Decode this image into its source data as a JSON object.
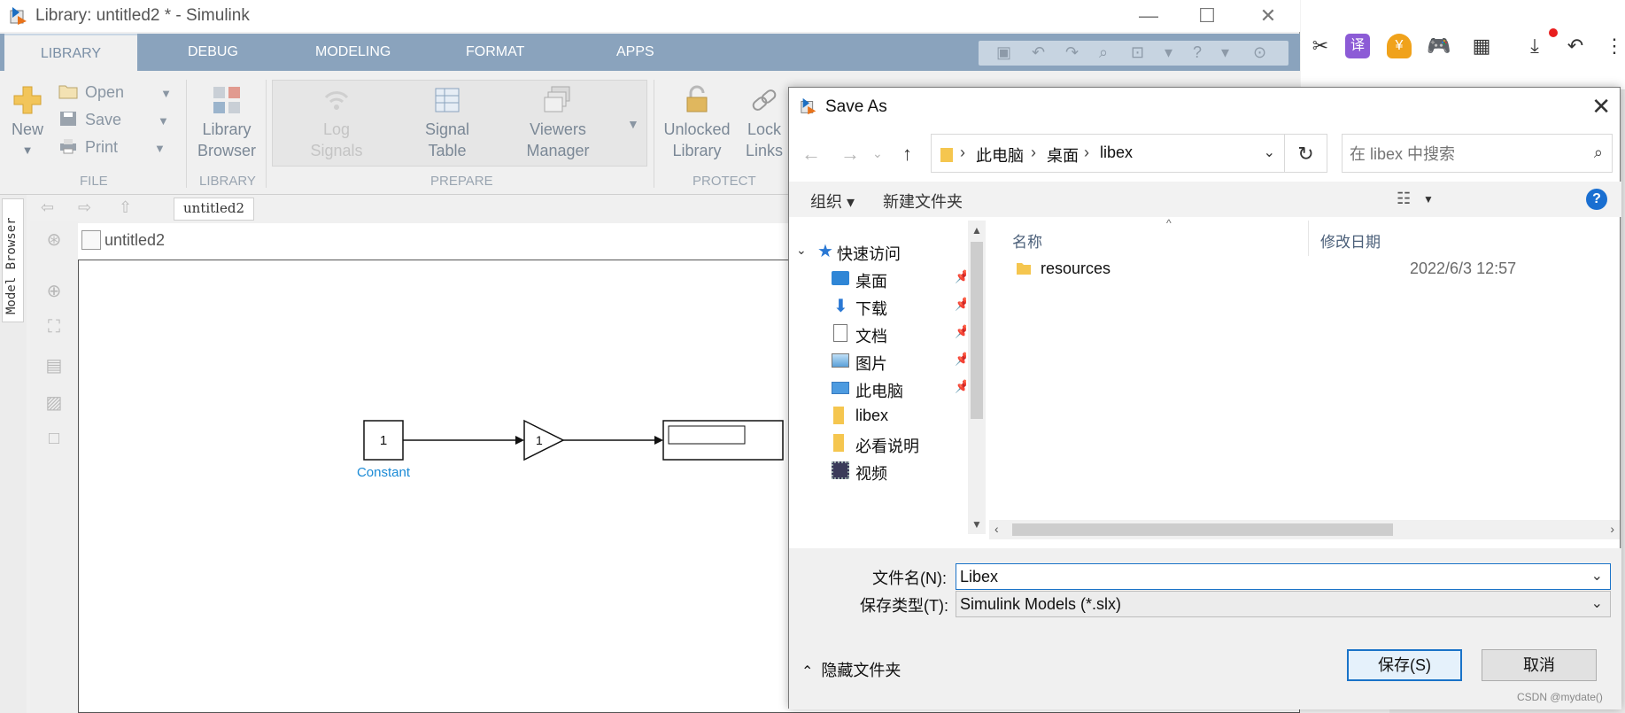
{
  "simulink": {
    "title": "Library: untitled2 * - Simulink",
    "tabs": [
      "LIBRARY",
      "DEBUG",
      "MODELING",
      "FORMAT",
      "APPS"
    ],
    "file_group": {
      "new": "New",
      "open": "Open",
      "save": "Save",
      "print": "Print",
      "group_label": "FILE"
    },
    "library_group": {
      "browser_line1": "Library",
      "browser_line2": "Browser",
      "group_label": "LIBRARY"
    },
    "prepare_group": {
      "log_line1": "Log",
      "log_line2": "Signals",
      "signal_line1": "Signal",
      "signal_line2": "Table",
      "viewers_line1": "Viewers",
      "viewers_line2": "Manager",
      "group_label": "PREPARE"
    },
    "protect_group": {
      "unlocked_line1": "Unlocked",
      "unlocked_line2": "Library",
      "lock_line1": "Lock",
      "lock_line2": "Links",
      "group_label": "PROTECT"
    },
    "side_tab": "Model Browser",
    "breadcrumb": "untitled2",
    "canvas_title": "untitled2",
    "blocks": {
      "constant_value": "1",
      "constant_label": "Constant",
      "gain_value": "1"
    }
  },
  "dialog": {
    "title": "Save As",
    "path": [
      "此电脑",
      "桌面",
      "libex"
    ],
    "search_placeholder": "在 libex 中搜索",
    "organize": "组织 ▾",
    "new_folder": "新建文件夹",
    "nav_items": [
      {
        "label": "快速访问",
        "icon": "star-icon",
        "pinned": false
      },
      {
        "label": "桌面",
        "icon": "desktop-icon",
        "pinned": true
      },
      {
        "label": "下载",
        "icon": "download-icon",
        "pinned": true
      },
      {
        "label": "文档",
        "icon": "document-icon",
        "pinned": true
      },
      {
        "label": "图片",
        "icon": "picture-icon",
        "pinned": true
      },
      {
        "label": "此电脑",
        "icon": "computer-icon",
        "pinned": true
      },
      {
        "label": "libex",
        "icon": "folder-icon",
        "pinned": false
      },
      {
        "label": "必看说明",
        "icon": "folder-icon",
        "pinned": false
      },
      {
        "label": "视频",
        "icon": "video-icon",
        "pinned": false
      }
    ],
    "columns": {
      "name": "名称",
      "date": "修改日期"
    },
    "files": [
      {
        "name": "resources",
        "date": "2022/6/3 12:57"
      }
    ],
    "filename_label": "文件名(N):",
    "filename_value": "Libex",
    "filetype_label": "保存类型(T):",
    "filetype_value": "Simulink Models (*.slx)",
    "hide_folders": "隐藏文件夹",
    "save_button": "保存(S)",
    "cancel_button": "取消"
  },
  "browser": {
    "icons": [
      "scissors-icon",
      "translate-icon",
      "yen-icon",
      "gamepad-icon",
      "apps-icon",
      "download-icon",
      "undo-icon",
      "more-icon"
    ],
    "translate_glyph": "译",
    "yen_glyph": "¥"
  },
  "watermark": "CSDN @mydate()",
  "colors": {
    "tab_bar": "#8aa3bd",
    "accent_blue": "#1a73c8",
    "constant_label": "#1a8ad6"
  }
}
